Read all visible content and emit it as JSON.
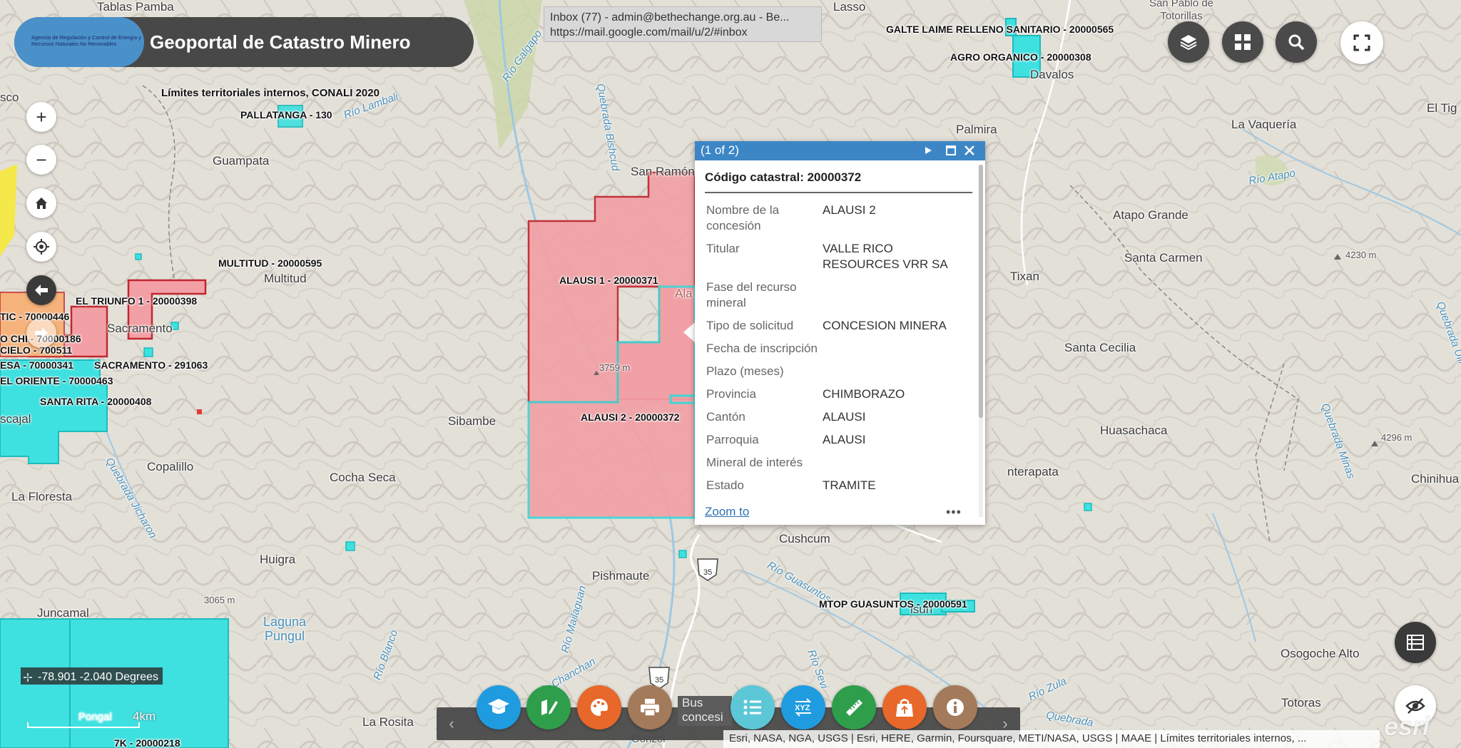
{
  "header": {
    "logo_text": "Agencia de Regulación y Control de Energía y Recursos Naturales No Renovables",
    "title": "Geoportal de Catastro Minero",
    "layer_title": "Límites territoriales internos, CONALI 2020"
  },
  "tooltip": {
    "line1": "Inbox (77) - admin@bethechange.org.au - Be...",
    "line2": "https://mail.google.com/mail/u/2/#inbox"
  },
  "map_controls": {
    "zoom_in": "+",
    "zoom_out": "−"
  },
  "popup": {
    "counter": "(1 of 2)",
    "title": "Código catastral: 20000372",
    "attributes": [
      {
        "key": "Nombre de la concesión",
        "value": "ALAUSI 2"
      },
      {
        "key": "Titular",
        "value": "VALLE RICO RESOURCES VRR SA"
      },
      {
        "key": "Fase del recurso mineral",
        "value": ""
      },
      {
        "key": "Tipo de solicitud",
        "value": "CONCESION MINERA"
      },
      {
        "key": "Fecha de inscripción",
        "value": ""
      },
      {
        "key": "Plazo (meses)",
        "value": ""
      },
      {
        "key": "Provincia",
        "value": "CHIMBORAZO"
      },
      {
        "key": "Cantón",
        "value": "ALAUSI"
      },
      {
        "key": "Parroquia",
        "value": "ALAUSI"
      },
      {
        "key": "Mineral de interés",
        "value": ""
      },
      {
        "key": "Estado",
        "value": "TRAMITE"
      }
    ],
    "zoom_to": "Zoom to",
    "more": "•••"
  },
  "coordinates": {
    "text": "-78.901 -2.040 Degrees"
  },
  "scale": {
    "label": "4km"
  },
  "broken_image_alt": "Bus concesi",
  "attribution": "Esri, NASA, NGA, USGS | Esri, HERE, Garmin, Foursquare, METI/NASA, USGS | MAAE | Límites territoriales internos, ...",
  "esri_logo": "esri",
  "concessions": [
    "GALTE LAIME RELLENO SANITARIO - 20000565",
    "AGRO ORGANICO - 20000308",
    "PALLATANGA - 130",
    "MULTITUD - 20000595",
    "ALAUSI 1 - 20000371",
    "ALAUSI 2 - 20000372",
    "EL TRIUNFO 1 - 20000398",
    "TIC - 70000446",
    "O CHI - 70000186",
    "CIELO - 700511",
    "SACRAMENTO - 291063",
    "ESA - 70000341",
    "EL ORIENTE - 70000463",
    "SANTA RITA - 20000408",
    "MTOP GUASUNTOS - 20000591",
    "7K - 20000218"
  ],
  "places": [
    "Tablas Pamba",
    "Lasso",
    "San Pablo de Totorillas",
    "Davalos",
    "Palmira",
    "La Vaquería",
    "El Tig",
    "sco",
    "Guampata",
    "San Ramón",
    "Atapo Grande",
    "Santa Carmen",
    "Tixan",
    "Multitud",
    "Sacramento",
    "Santa Cecilia",
    "Sibambe",
    "Huasachaca",
    "Copalillo",
    "Cocha Seca",
    "La Floresta",
    "nterapata",
    "Chinihua",
    "Cushcum",
    "Pishmaute",
    "Huigra",
    "Juncamal",
    "Osogoche Alto",
    "Totoras",
    "La Rosita",
    "Gonzol",
    "scajal",
    "Ala",
    "Pongal",
    "isun"
  ],
  "water_labels": [
    "Río Galgapo",
    "Río Lambali",
    "Quebrada Bishcud",
    "Río Atapo",
    "Quebrada Jicharon",
    "Laguna Pungul",
    "Río Mailaguan",
    "Río Guasuntos",
    "Río Blanco",
    "Río Sevi",
    "Río Zula",
    "Quebrada Ulli",
    "Quebrada Minas",
    "Río Chanchan",
    "Quebrada"
  ],
  "elevations": [
    "3759 m",
    "4230 m",
    "4296 m",
    "3065 m"
  ],
  "shields": [
    "35",
    "35"
  ],
  "colors": {
    "concession_red_fill": "#f2a0a6",
    "concession_red_stroke": "#c0262e",
    "concession_cyan_fill": "#3ee0e0",
    "concession_cyan_stroke": "#1fbcbc",
    "popup_header": "#3d86c6",
    "title_bar": "#3c3c3c"
  },
  "tools": [
    {
      "name": "education-tool",
      "color": "#1f9be0"
    },
    {
      "name": "edit-tool",
      "color": "#2e9e4b"
    },
    {
      "name": "style-tool",
      "color": "#e8672a"
    },
    {
      "name": "print-tool",
      "color": "#a37a5a"
    },
    {
      "name": "list-tool",
      "color": "#5cc7d6"
    },
    {
      "name": "xyz-tool",
      "color": "#1f9be0"
    },
    {
      "name": "measure-tool",
      "color": "#2e9e4b"
    },
    {
      "name": "export-tool",
      "color": "#e8672a"
    },
    {
      "name": "info-tool",
      "color": "#a37a5a"
    }
  ]
}
